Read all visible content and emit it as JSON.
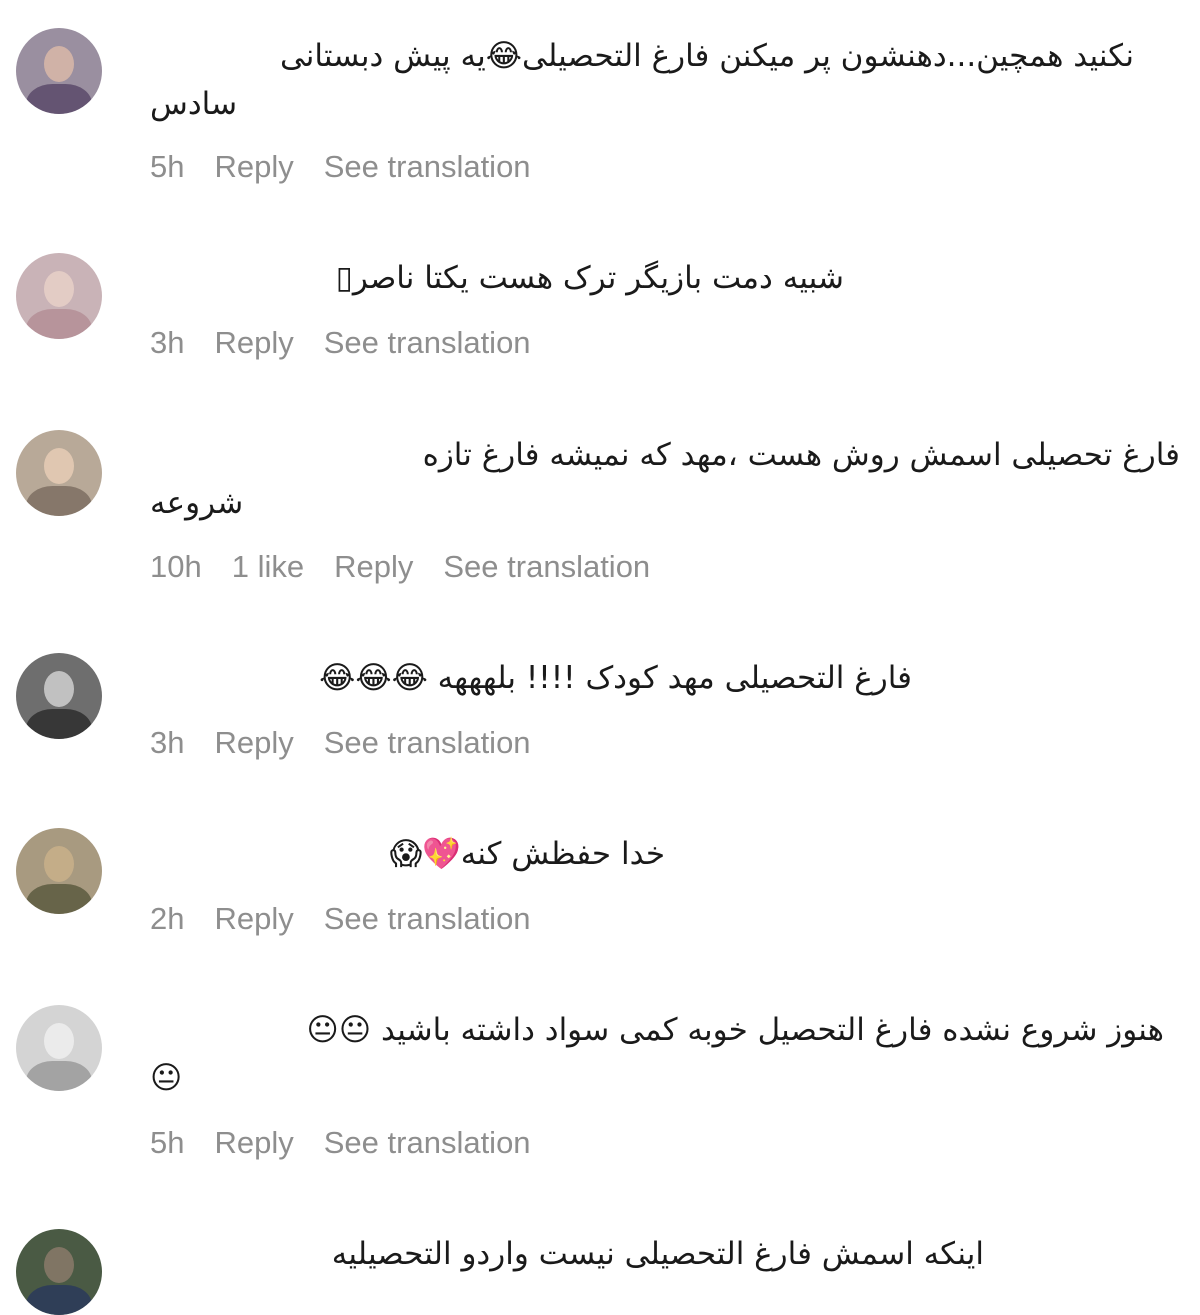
{
  "comments": [
    {
      "avatar_colors": {
        "bg": "#9a8fa0",
        "face": "#d9b8a8",
        "body": "#5a4a6a"
      },
      "lines": [
        "نکنید همچین...دهنشون پر میکنن فارغ التحصیلی😂یه پیش دبستانی",
        "سادس"
      ],
      "time": "5h",
      "likes": "",
      "reply": "Reply",
      "translate": "See translation"
    },
    {
      "avatar_colors": {
        "bg": "#c9b3b7",
        "face": "#e8d0c8",
        "body": "#b48e96"
      },
      "lines": [
        "شبیه دمت بازیگر ترک هست یکتا ناصر▯"
      ],
      "time": "3h",
      "likes": "",
      "reply": "Reply",
      "translate": "See translation"
    },
    {
      "avatar_colors": {
        "bg": "#b8a998",
        "face": "#e6cdb5",
        "body": "#7c6e62"
      },
      "lines": [
        "فارغ تحصیلی اسمش روش هست ،مهد که نمیشه فارغ تازه",
        "شروعه"
      ],
      "time": "10h",
      "likes": "1 like",
      "reply": "Reply",
      "translate": "See translation"
    },
    {
      "avatar_colors": {
        "bg": "#6e6e6e",
        "face": "#d0d0d0",
        "body": "#2e2e2e"
      },
      "lines": [
        "فارغ التحصیلی مهد کودک !!!! بلهههه 😂😂😂"
      ],
      "time": "3h",
      "likes": "",
      "reply": "Reply",
      "translate": "See translation"
    },
    {
      "avatar_colors": {
        "bg": "#a89a80",
        "face": "#c9b08a",
        "body": "#5c5a40"
      },
      "lines": [
        "خدا حفظش کنه💖😱"
      ],
      "time": "2h",
      "likes": "",
      "reply": "Reply",
      "translate": "See translation"
    },
    {
      "avatar_colors": {
        "bg": "#d4d4d4",
        "face": "#eeeeee",
        "body": "#9a9a9a"
      },
      "lines": [
        "هنوز شروع نشده فارغ التحصیل خوبه کمی سواد داشته باشید 😐😐",
        "😐"
      ],
      "time": "5h",
      "likes": "",
      "reply": "Reply",
      "translate": "See translation"
    },
    {
      "avatar_colors": {
        "bg": "#4a5a44",
        "face": "#8a7a6a",
        "body": "#2a3a5a"
      },
      "lines": [
        "اینکه اسمش فارغ التحصیلی نیست واردو التحصیلیه"
      ],
      "time": "",
      "likes": "",
      "reply": "",
      "translate": ""
    }
  ]
}
